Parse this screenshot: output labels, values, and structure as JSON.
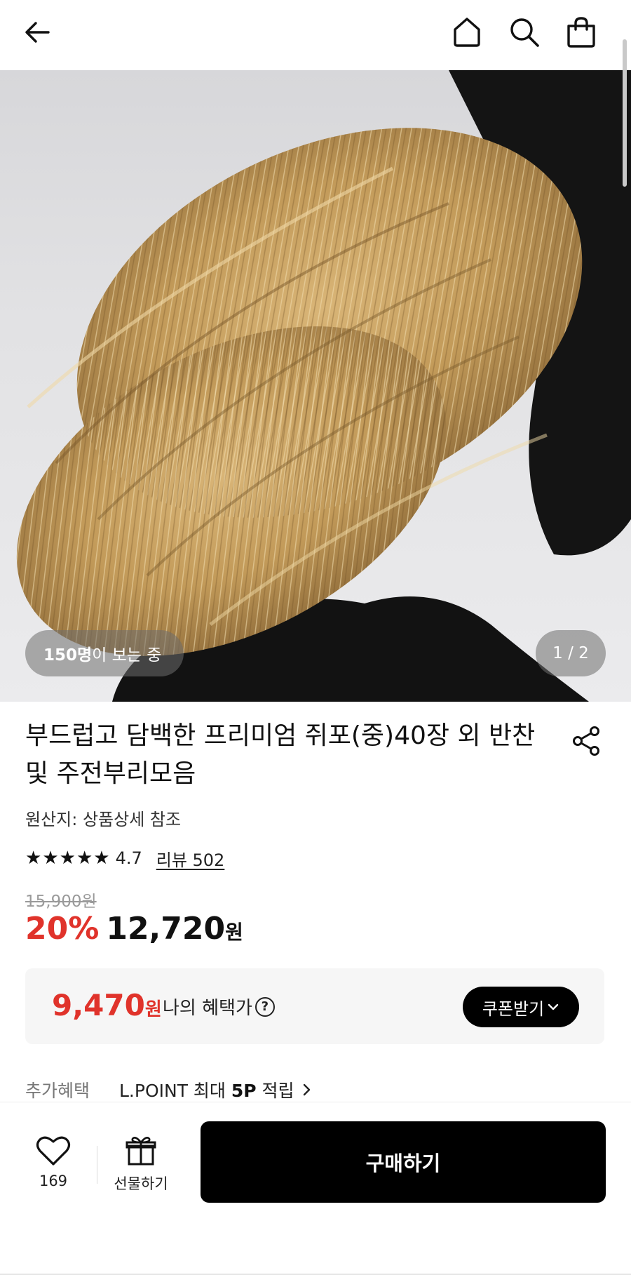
{
  "header": {
    "back_icon": "arrow-left-icon",
    "home_icon": "home-icon",
    "search_icon": "search-icon",
    "cart_icon": "shopping-bag-icon"
  },
  "gallery": {
    "viewers_count": "150명",
    "viewers_suffix": "이 보는 중",
    "page_indicator": "1 / 2",
    "current_page": 1,
    "total_pages": 2
  },
  "product": {
    "title": "부드럽고 담백한 프리미엄 쥐포(중)40장 외 반찬 및 주전부리모음",
    "origin": "원산지: 상품상세 참조",
    "rating": "4.7",
    "rating_stars": 4.7,
    "review_link": "리뷰 502",
    "original_price": "15,900원",
    "discount_rate": "20%",
    "price": "12,720",
    "price_unit": "원"
  },
  "benefit": {
    "price": "9,470",
    "price_unit": "원",
    "label": "나의 혜택가",
    "help": "?",
    "coupon_button": "쿠폰받기"
  },
  "extra_benefit": {
    "label": "추가혜택",
    "text_prefix": "L.POINT 최대 ",
    "text_bold": "5P",
    "text_suffix": " 적립"
  },
  "bottom_bar": {
    "like_count": "169",
    "gift_label": "선물하기",
    "buy_label": "구매하기"
  },
  "colors": {
    "discount_red": "#e0332b",
    "primary_black": "#000000"
  }
}
